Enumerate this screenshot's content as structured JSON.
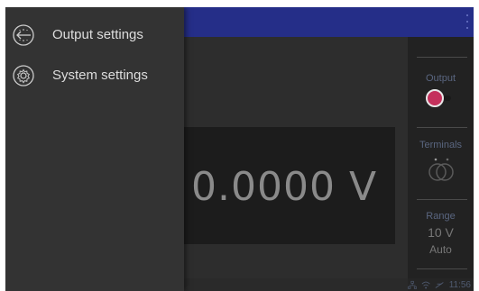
{
  "drawer": {
    "items": [
      {
        "label": "Output settings",
        "icon": "output-settings-icon"
      },
      {
        "label": "System settings",
        "icon": "gear-icon"
      }
    ]
  },
  "display": {
    "value": "0.0000 V"
  },
  "panel": {
    "output_label": "Output",
    "terminals_label": "Terminals",
    "range_label": "Range",
    "range_value": "10 V",
    "range_mode": "Auto"
  },
  "status": {
    "time": "11:56"
  },
  "colors": {
    "topbar": "#252e88",
    "output_knob": "#c4315c",
    "panel_label": "#5a6680"
  }
}
